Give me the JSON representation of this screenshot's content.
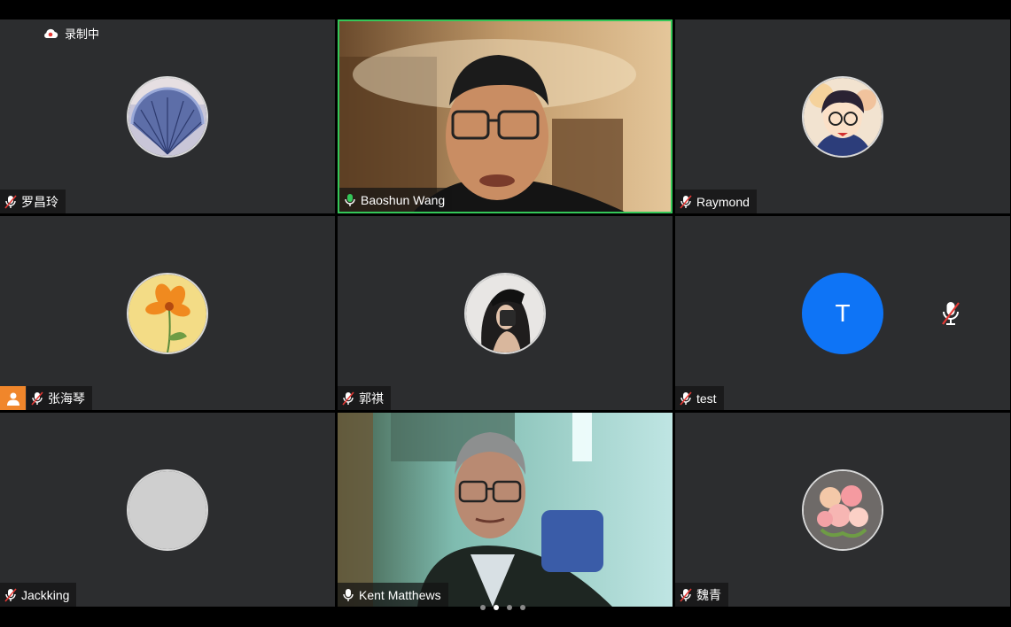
{
  "recording": {
    "label": "录制中"
  },
  "participants": [
    {
      "name": "罗昌玲",
      "mic": "muted",
      "avatar": "fan-image-avatar"
    },
    {
      "name": "Baoshun Wang",
      "mic": "active",
      "video": true,
      "speaking": true
    },
    {
      "name": "Raymond",
      "mic": "muted",
      "avatar": "cartoon-detective-avatar"
    },
    {
      "name": "张海琴",
      "mic": "muted",
      "avatar": "orange-flower-avatar",
      "host": true
    },
    {
      "name": "郭祺",
      "mic": "muted",
      "avatar": "girl-photo-avatar"
    },
    {
      "name": "test",
      "mic": "muted",
      "avatar_letter": "T",
      "avatar_color": "#0e74f6"
    },
    {
      "name": "Jackking",
      "mic": "muted",
      "avatar": "blank-gray-avatar"
    },
    {
      "name": "Kent Matthews",
      "mic": "active",
      "video": true
    },
    {
      "name": "魏青",
      "mic": "muted",
      "avatar": "rose-bouquet-avatar"
    }
  ],
  "pagination": {
    "total": 4,
    "current": 2
  },
  "colors": {
    "tile_bg": "#2c2d2f",
    "speaking_border": "#34c759",
    "muted_red": "#e53935",
    "host_orange": "#f0862b",
    "letter_avatar": "#0e74f6"
  }
}
